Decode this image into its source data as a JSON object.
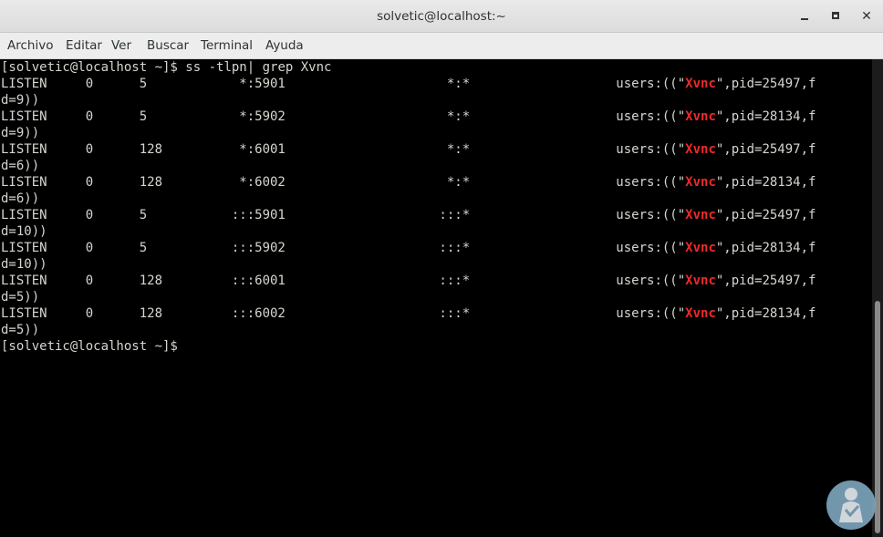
{
  "window": {
    "title": "solvetic@localhost:~",
    "minimize": "minimize",
    "maximize": "maximize",
    "close": "close"
  },
  "menu": {
    "items": [
      "Archivo",
      "Editar",
      "Ver",
      "Buscar",
      "Terminal",
      "Ayuda"
    ]
  },
  "terminal": {
    "prompt": "[solvetic@localhost ~]$",
    "command": " ss -tlpn| grep Xvnc",
    "highlight": "Xvnc",
    "highlight_color": "#ef2929",
    "text_color": "#d3d7cf",
    "rows": [
      {
        "state": "LISTEN",
        "recvq": "0",
        "sendq": "5",
        "local": "*:5901",
        "peer": "*:*",
        "users_prefix": "users:((\"",
        "proc": "Xvnc",
        "users_suffix": "\",pid=25497,f",
        "wrap": "d=9))"
      },
      {
        "state": "LISTEN",
        "recvq": "0",
        "sendq": "5",
        "local": "*:5902",
        "peer": "*:*",
        "users_prefix": "users:((\"",
        "proc": "Xvnc",
        "users_suffix": "\",pid=28134,f",
        "wrap": "d=9))"
      },
      {
        "state": "LISTEN",
        "recvq": "0",
        "sendq": "128",
        "local": "*:6001",
        "peer": "*:*",
        "users_prefix": "users:((\"",
        "proc": "Xvnc",
        "users_suffix": "\",pid=25497,f",
        "wrap": "d=6))"
      },
      {
        "state": "LISTEN",
        "recvq": "0",
        "sendq": "128",
        "local": "*:6002",
        "peer": "*:*",
        "users_prefix": "users:((\"",
        "proc": "Xvnc",
        "users_suffix": "\",pid=28134,f",
        "wrap": "d=6))"
      },
      {
        "state": "LISTEN",
        "recvq": "0",
        "sendq": "5",
        "local": ":::5901",
        "peer": ":::*",
        "users_prefix": "users:((\"",
        "proc": "Xvnc",
        "users_suffix": "\",pid=25497,f",
        "wrap": "d=10))"
      },
      {
        "state": "LISTEN",
        "recvq": "0",
        "sendq": "5",
        "local": ":::5902",
        "peer": ":::*",
        "users_prefix": "users:((\"",
        "proc": "Xvnc",
        "users_suffix": "\",pid=28134,f",
        "wrap": "d=10))"
      },
      {
        "state": "LISTEN",
        "recvq": "0",
        "sendq": "128",
        "local": ":::6001",
        "peer": ":::*",
        "users_prefix": "users:((\"",
        "proc": "Xvnc",
        "users_suffix": "\",pid=25497,f",
        "wrap": "d=5))"
      },
      {
        "state": "LISTEN",
        "recvq": "0",
        "sendq": "128",
        "local": ":::6002",
        "peer": ":::*",
        "users_prefix": "users:((\"",
        "proc": "Xvnc",
        "users_suffix": "\",pid=28134,f",
        "wrap": "d=5))"
      }
    ],
    "final_prompt": "[solvetic@localhost ~]$"
  }
}
